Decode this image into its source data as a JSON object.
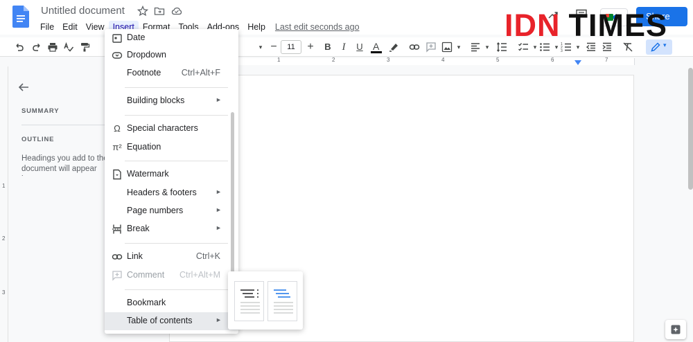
{
  "app": {
    "doc_title": "Untitled document",
    "last_edit": "Last edit seconds ago",
    "share_label": "Share"
  },
  "menubar": [
    "File",
    "Edit",
    "View",
    "Insert",
    "Format",
    "Tools",
    "Add-ons",
    "Help"
  ],
  "watermark": {
    "part1": "IDN",
    "part2": "TIMES"
  },
  "toolbar": {
    "font_size": "11",
    "bold": "B",
    "italic": "I",
    "underline": "U",
    "text_color": "A"
  },
  "ruler": {
    "numbers": [
      "1",
      "2",
      "3",
      "4",
      "5",
      "6",
      "7"
    ],
    "v_numbers": [
      "1",
      "2",
      "3"
    ]
  },
  "sidebar": {
    "summary_label": "SUMMARY",
    "outline_label": "OUTLINE",
    "outline_hint": "Headings you add to the document will appear here."
  },
  "insert_menu": {
    "items": [
      {
        "label": "Date",
        "icon": "date-icon"
      },
      {
        "label": "Dropdown",
        "icon": "dropdown-icon"
      },
      {
        "label": "Footnote",
        "shortcut": "Ctrl+Alt+F"
      },
      {
        "label": "Building blocks",
        "submenu": true
      },
      {
        "label": "Special characters",
        "icon": "omega-icon"
      },
      {
        "label": "Equation",
        "icon": "pi-icon"
      },
      {
        "label": "Watermark",
        "icon": "watermark-icon"
      },
      {
        "label": "Headers & footers",
        "submenu": true
      },
      {
        "label": "Page numbers",
        "submenu": true
      },
      {
        "label": "Break",
        "icon": "break-icon",
        "submenu": true
      },
      {
        "label": "Link",
        "icon": "link-icon",
        "shortcut": "Ctrl+K"
      },
      {
        "label": "Comment",
        "icon": "comment-icon",
        "shortcut": "Ctrl+Alt+M",
        "disabled": true
      },
      {
        "label": "Bookmark"
      },
      {
        "label": "Table of contents",
        "submenu": true,
        "highlighted": true
      }
    ],
    "submenu_arrow": "►"
  },
  "toc_submenu": {
    "options": [
      "toc-with-page-numbers",
      "toc-with-blue-links"
    ]
  },
  "colors": {
    "accent": "#1a73e8",
    "menu_highlight": "#e8eaed",
    "watermark_red": "#e8232a"
  }
}
